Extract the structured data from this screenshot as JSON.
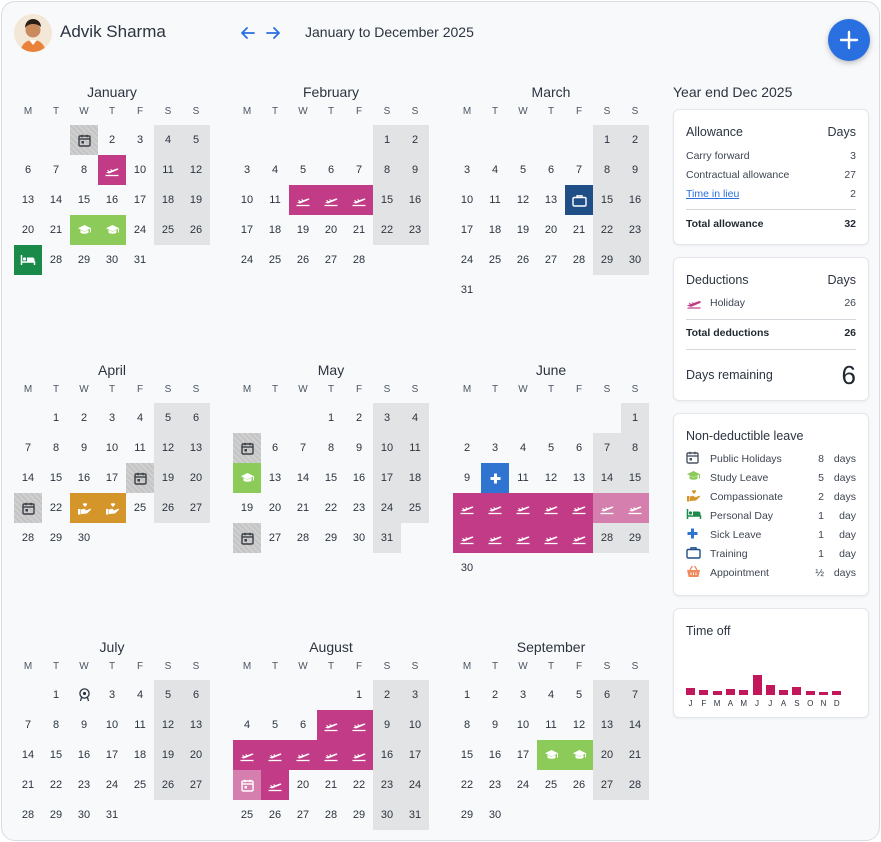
{
  "header": {
    "user_name": "Advik Sharma",
    "date_range": "January to December 2025"
  },
  "weekday_letters": [
    "M",
    "T",
    "W",
    "T",
    "F",
    "S",
    "S"
  ],
  "months": [
    {
      "name": "January",
      "first_weekday": 2,
      "days": 31
    },
    {
      "name": "February",
      "first_weekday": 5,
      "days": 28
    },
    {
      "name": "March",
      "first_weekday": 5,
      "days": 31
    },
    {
      "name": "April",
      "first_weekday": 1,
      "days": 30
    },
    {
      "name": "May",
      "first_weekday": 3,
      "days": 31
    },
    {
      "name": "June",
      "first_weekday": 6,
      "days": 30
    },
    {
      "name": "July",
      "first_weekday": 1,
      "days": 31
    },
    {
      "name": "August",
      "first_weekday": 4,
      "days": 31
    },
    {
      "name": "September",
      "first_weekday": 0,
      "days": 30
    }
  ],
  "leave_days": {
    "January": {
      "1": "pub",
      "9": "hol",
      "22": "study",
      "23": "study",
      "27": "pers"
    },
    "February": {
      "12": "hol",
      "13": "hol",
      "14": "hol"
    },
    "March": {
      "14": "train"
    },
    "April": {
      "18": "pub",
      "21": "pub",
      "23": "comp",
      "24": "comp"
    },
    "May": {
      "5": "pub",
      "12": "study",
      "26": "pub"
    },
    "June": {
      "10": "sick",
      "16": "hol",
      "17": "hol",
      "18": "hol",
      "19": "hol",
      "20": "hol",
      "21": "holp",
      "22": "holp",
      "23": "hol",
      "24": "hol",
      "25": "hol",
      "26": "hol",
      "27": "hol"
    },
    "July": {
      "2": "appt"
    },
    "August": {
      "7": "hol",
      "8": "hol",
      "11": "hol",
      "12": "hol",
      "13": "hol",
      "14": "hol",
      "15": "hol",
      "18": "pubhol",
      "19": "hol"
    },
    "September": {
      "18": "study",
      "19": "study"
    }
  },
  "summary": {
    "title": "Year end Dec 2025",
    "allowance": {
      "heading": "Allowance",
      "days_heading": "Days",
      "rows": [
        {
          "label": "Carry forward",
          "value": "3"
        },
        {
          "label": "Contractual allowance",
          "value": "27"
        },
        {
          "label": "Time in lieu",
          "value": "2"
        }
      ],
      "total_label": "Total allowance",
      "total_value": "32"
    },
    "deductions": {
      "heading": "Deductions",
      "days_heading": "Days",
      "holiday_label": "Holiday",
      "holiday_value": "26",
      "total_label": "Total deductions",
      "total_value": "26",
      "remaining_label": "Days remaining",
      "remaining_value": "6"
    },
    "non_deductible": {
      "heading": "Non-deductible leave",
      "rows": [
        {
          "label": "Public Holidays",
          "count": "8",
          "unit": "days",
          "icon": "calendar-icon"
        },
        {
          "label": "Study Leave",
          "count": "5",
          "unit": "days",
          "icon": "graduation-cap-icon"
        },
        {
          "label": "Compassionate",
          "count": "2",
          "unit": "days",
          "icon": "compassion-hand-icon"
        },
        {
          "label": "Personal Day",
          "count": "1",
          "unit": "day",
          "icon": "bed-icon"
        },
        {
          "label": "Sick Leave",
          "count": "1",
          "unit": "day",
          "icon": "medical-cross-icon"
        },
        {
          "label": "Training",
          "count": "1",
          "unit": "day",
          "icon": "briefcase-icon"
        },
        {
          "label": "Appointment",
          "count": "½",
          "unit": "days",
          "icon": "basket-icon"
        }
      ]
    },
    "time_off": {
      "heading": "Time off",
      "months": [
        "J",
        "F",
        "M",
        "A",
        "M",
        "J",
        "J",
        "A",
        "S",
        "O",
        "N",
        "D"
      ],
      "values": [
        2,
        1.5,
        1,
        1.7,
        1.5,
        5.5,
        2.7,
        1.3,
        2.2,
        1.1,
        0.8,
        1
      ]
    }
  },
  "colors": {
    "holiday": "#c13b86",
    "study": "#8ccb5a",
    "compassionate": "#d4952a",
    "personal": "#198a4a",
    "sick": "#2f74d0",
    "training": "#1f4f86",
    "weekend": "#e2e3e4",
    "accent": "#2a6fe0",
    "chart_bar": "#c2185b"
  }
}
